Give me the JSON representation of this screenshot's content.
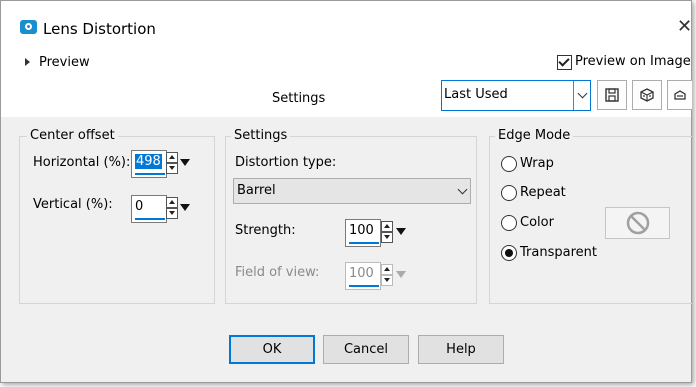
{
  "window": {
    "title": "Lens Distortion"
  },
  "preview": {
    "expander_label": "Preview",
    "preview_on_image_label": "Preview on Image",
    "preview_on_image_checked": true
  },
  "settings_bar": {
    "label": "Settings",
    "preset_value": "Last Used"
  },
  "toolbar": {
    "icons": [
      "save-icon",
      "randomize-icon",
      "reset-icon"
    ]
  },
  "center_offset": {
    "group_label": "Center offset",
    "horizontal_label": "Horizontal (%):",
    "horizontal_value": "498",
    "vertical_label": "Vertical (%):",
    "vertical_value": "0"
  },
  "settings_group": {
    "group_label": "Settings",
    "distortion_type_label": "Distortion type:",
    "distortion_type_value": "Barrel",
    "strength_label": "Strength:",
    "strength_value": "100",
    "field_of_view_label": "Field of view:",
    "field_of_view_value": "100"
  },
  "edge_mode": {
    "group_label": "Edge Mode",
    "options": [
      "Wrap",
      "Repeat",
      "Color",
      "Transparent"
    ],
    "selected": "Transparent"
  },
  "buttons": {
    "ok": "OK",
    "cancel": "Cancel",
    "help": "Help"
  },
  "colors": {
    "accent": "#0078d7",
    "dialog_bg": "#f0f0f0",
    "icon_blue": "#1a8fd0"
  }
}
